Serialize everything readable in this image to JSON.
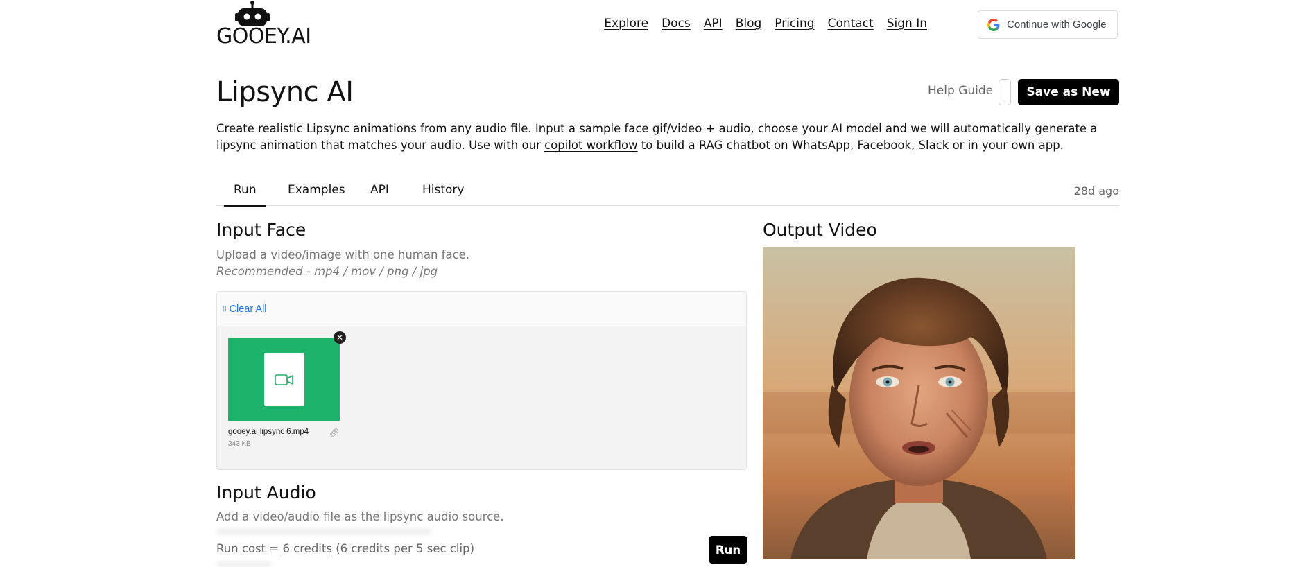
{
  "brand": {
    "logo_text": "GOOEY.AI"
  },
  "nav": {
    "links": [
      "Explore",
      "Docs",
      "API",
      "Blog",
      "Pricing",
      "Contact",
      "Sign In"
    ],
    "google_button": "Continue with Google"
  },
  "header": {
    "title": "Lipsync AI",
    "help_guide": "Help Guide",
    "save_button": "Save as New"
  },
  "description": {
    "part1": "Create realistic Lipsync animations from any audio file. Input a sample face gif/video + audio, choose your AI model and we will automatically generate a lipsync animation that matches your audio. Use with our ",
    "link": "copilot workflow",
    "part2": " to build a RAG chatbot on WhatsApp, Facebook, Slack or in your own app."
  },
  "tabs": {
    "items": [
      "Run",
      "Examples",
      "API",
      "History"
    ],
    "active": "Run",
    "timestamp": "28d ago"
  },
  "input_face": {
    "title": "Input Face",
    "hint": "Upload a video/image with one human face.",
    "hint_italic": "Recommended - mp4 / mov / png / jpg",
    "clear_all": "Clear All",
    "file": {
      "name": "gooey.ai lipsync 6.mp4",
      "size": "343 KB"
    }
  },
  "input_audio": {
    "title": "Input Audio",
    "hint": "Add a video/audio file as the lipsync audio source."
  },
  "run": {
    "cost_prefix": "Run cost = ",
    "cost_link": "6 credits",
    "cost_suffix": " (6 credits per 5 sec clip)",
    "button": "Run"
  },
  "output": {
    "title": "Output Video"
  },
  "colors": {
    "accent": "#000000",
    "link": "#1a73e8",
    "file_thumb": "#1db36a"
  }
}
